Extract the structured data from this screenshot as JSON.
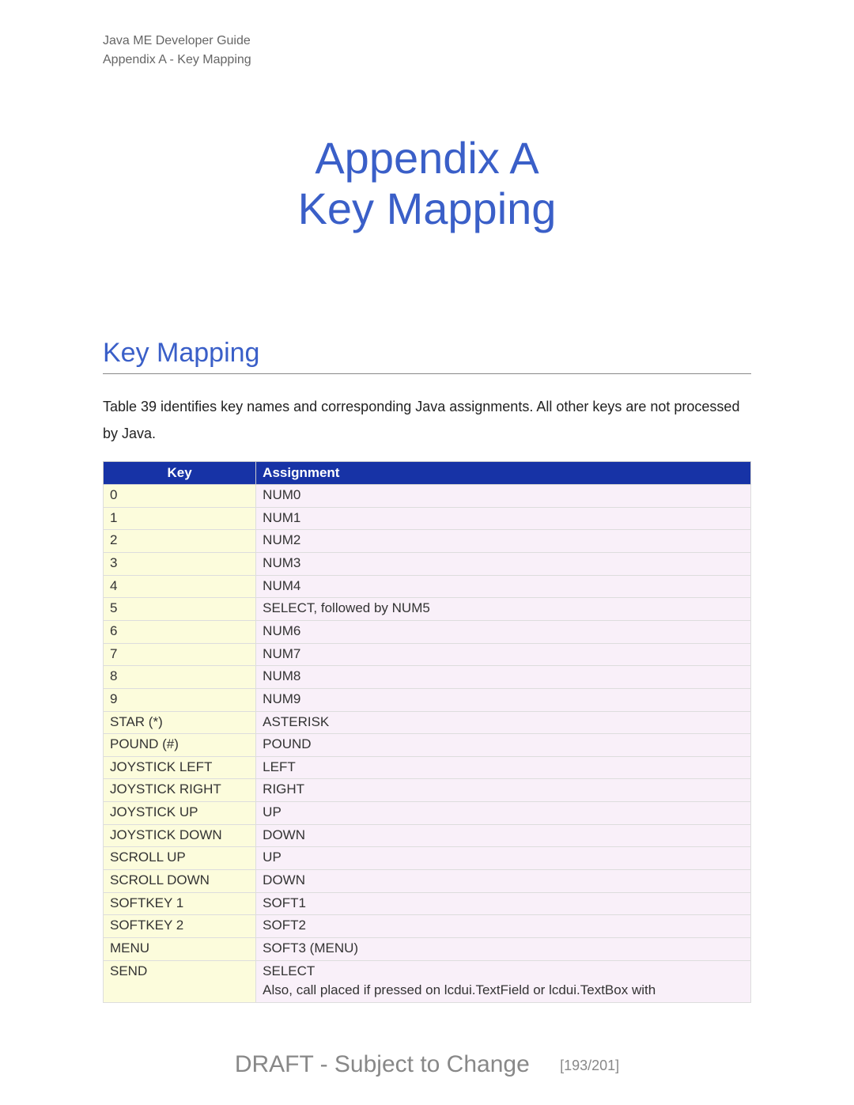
{
  "header": {
    "line1": "Java ME Developer Guide",
    "line2": "Appendix A - Key Mapping"
  },
  "title": {
    "line1": "Appendix A",
    "line2": "Key Mapping"
  },
  "section_heading": "Key Mapping",
  "intro": "Table 39 identifies key names and corresponding Java assignments. All other keys are not processed by Java.",
  "table": {
    "headers": {
      "key": "Key",
      "assignment": "Assignment"
    },
    "rows": [
      {
        "key": "0",
        "assignment": "NUM0"
      },
      {
        "key": "1",
        "assignment": "NUM1"
      },
      {
        "key": "2",
        "assignment": "NUM2"
      },
      {
        "key": "3",
        "assignment": "NUM3"
      },
      {
        "key": "4",
        "assignment": "NUM4"
      },
      {
        "key": "5",
        "assignment": "SELECT, followed by NUM5"
      },
      {
        "key": "6",
        "assignment": "NUM6"
      },
      {
        "key": "7",
        "assignment": "NUM7"
      },
      {
        "key": "8",
        "assignment": "NUM8"
      },
      {
        "key": "9",
        "assignment": "NUM9"
      },
      {
        "key": "STAR (*)",
        "assignment": "ASTERISK"
      },
      {
        "key": "POUND (#)",
        "assignment": "POUND"
      },
      {
        "key": "JOYSTICK LEFT",
        "assignment": "LEFT"
      },
      {
        "key": "JOYSTICK RIGHT",
        "assignment": "RIGHT"
      },
      {
        "key": "JOYSTICK UP",
        "assignment": "UP"
      },
      {
        "key": "JOYSTICK DOWN",
        "assignment": "DOWN"
      },
      {
        "key": "SCROLL UP",
        "assignment": "UP"
      },
      {
        "key": "SCROLL DOWN",
        "assignment": "DOWN"
      },
      {
        "key": "SOFTKEY 1",
        "assignment": "SOFT1"
      },
      {
        "key": "SOFTKEY 2",
        "assignment": "SOFT2"
      },
      {
        "key": "MENU",
        "assignment": "SOFT3 (MENU)"
      },
      {
        "key": "SEND",
        "assignment": "SELECT\nAlso, call placed if pressed on lcdui.TextField or lcdui.TextBox with"
      }
    ]
  },
  "footer": {
    "draft": "DRAFT - Subject to Change",
    "page": "[193/201]"
  }
}
